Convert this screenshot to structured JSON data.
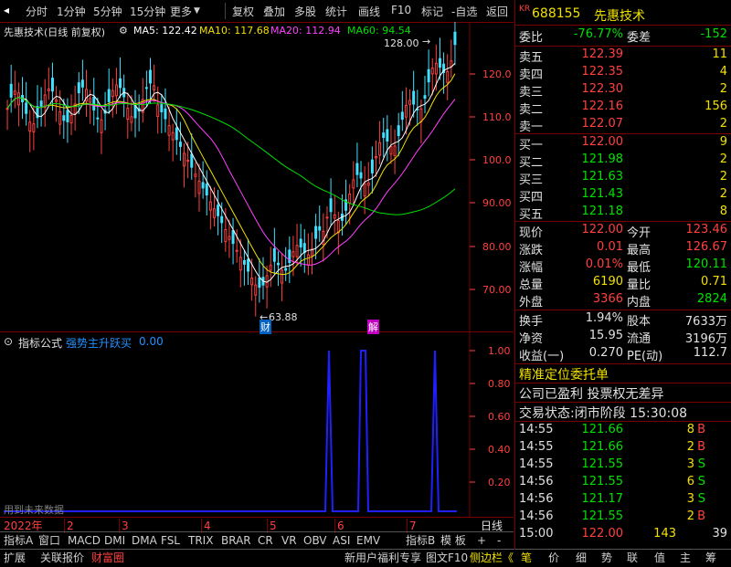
{
  "toolbar": {
    "items": [
      "分时",
      "1分钟",
      "5分钟",
      "15分钟",
      "更多",
      "复权",
      "叠加",
      "多股",
      "统计",
      "画线",
      "F10",
      "标记",
      "-自选",
      "返回"
    ]
  },
  "chart": {
    "stock_label": "先惠技术(日线 前复权)",
    "ma5": "MA5: 122.42",
    "ma10": "MA10: 117.68",
    "ma20": "MA20: 112.94",
    "ma60": "MA60: 94.54",
    "price_ticks": [
      "120.0",
      "110.0",
      "100.0",
      "90.00",
      "80.00",
      "70.00"
    ],
    "high_mark": "128.00",
    "low_mark": "63.88",
    "marker_cai": "财",
    "marker_jie": "解",
    "colors": {
      "ma5": "#ffffff",
      "ma10": "#f0e000",
      "ma20": "#ff40ff",
      "ma60": "#00e000",
      "up": "#ff4040",
      "down": "#40e0ff",
      "signal": "#2020ff"
    }
  },
  "indicator": {
    "title": "指标公式",
    "name": "强势主升跃买",
    "value": "0.00",
    "ticks": [
      "1.00",
      "0.80",
      "0.60",
      "0.40",
      "0.20"
    ],
    "note": "用到未来数据"
  },
  "time_axis": {
    "labels": [
      "2022年",
      "2",
      "3",
      "4",
      "5",
      "6",
      "7"
    ],
    "right_label": "日线"
  },
  "index_bar": {
    "items": [
      "指标A",
      "窗口",
      "MACD",
      "DMI",
      "DMA",
      "FSL",
      "TRIX",
      "BRAR",
      "CR",
      "VR",
      "OBV",
      "ASI",
      "EMV"
    ],
    "right_items": [
      "指标B",
      "模 板",
      "+",
      "-"
    ]
  },
  "bottom_bar": {
    "left": [
      "扩展",
      "关联报价",
      "财富圈"
    ],
    "middle": "新用户福利专享",
    "right": [
      "图文F10",
      "侧边栏《"
    ],
    "tabs": [
      "笔",
      "价",
      "细",
      "势",
      "联",
      "值",
      "主",
      "筹"
    ]
  },
  "quote": {
    "kr": "KR",
    "code": "688155",
    "name": "先惠技术",
    "webi_label": "委比",
    "webi": "-76.77%",
    "weicha_label": "委差",
    "weicha": "-152",
    "asks": [
      {
        "label": "卖五",
        "price": "122.39",
        "vol": "11"
      },
      {
        "label": "卖四",
        "price": "122.35",
        "vol": "4"
      },
      {
        "label": "卖三",
        "price": "122.30",
        "vol": "2"
      },
      {
        "label": "卖二",
        "price": "122.16",
        "vol": "156"
      },
      {
        "label": "卖一",
        "price": "122.07",
        "vol": "2"
      }
    ],
    "bids": [
      {
        "label": "买一",
        "price": "122.00",
        "vol": "9"
      },
      {
        "label": "买二",
        "price": "121.98",
        "vol": "2"
      },
      {
        "label": "买三",
        "price": "121.63",
        "vol": "2"
      },
      {
        "label": "买四",
        "price": "121.43",
        "vol": "2"
      },
      {
        "label": "买五",
        "price": "121.18",
        "vol": "8"
      }
    ],
    "stats": [
      {
        "l1": "现价",
        "v1": "122.00",
        "l2": "今开",
        "v2": "123.46"
      },
      {
        "l1": "涨跌",
        "v1": "0.01",
        "l2": "最高",
        "v2": "126.67"
      },
      {
        "l1": "涨幅",
        "v1": "0.01%",
        "l2": "最低",
        "v2": "120.11"
      },
      {
        "l1": "总量",
        "v1": "6190",
        "l2": "量比",
        "v2": "0.71"
      },
      {
        "l1": "外盘",
        "v1": "3366",
        "l2": "内盘",
        "v2": "2824"
      }
    ],
    "stats2": [
      {
        "l1": "换手",
        "v1": "1.94%",
        "l2": "股本",
        "v2": "7633万"
      },
      {
        "l1": "净资",
        "v1": "15.95",
        "l2": "流通",
        "v2": "3196万"
      },
      {
        "l1": "收益(一)",
        "v1": "0.270",
        "l2": "PE(动)",
        "v2": "112.7"
      }
    ],
    "entrust": "精准定位委托单",
    "profit_line": "公司已盈利 投票权无差异",
    "trade_status": "交易状态:闭市阶段 15:30:08",
    "ticks": [
      {
        "time": "14:55",
        "price": "121.66",
        "vol": "8",
        "side": "B"
      },
      {
        "time": "14:55",
        "price": "121.66",
        "vol": "2",
        "side": "B"
      },
      {
        "time": "14:55",
        "price": "121.55",
        "vol": "3",
        "side": "S"
      },
      {
        "time": "14:56",
        "price": "121.55",
        "vol": "6",
        "side": "S"
      },
      {
        "time": "14:56",
        "price": "121.17",
        "vol": "3",
        "side": "S"
      },
      {
        "time": "14:56",
        "price": "121.55",
        "vol": "2",
        "side": "B"
      },
      {
        "time": "15:00",
        "price": "122.00",
        "vol": "143",
        "side": "39"
      }
    ]
  }
}
